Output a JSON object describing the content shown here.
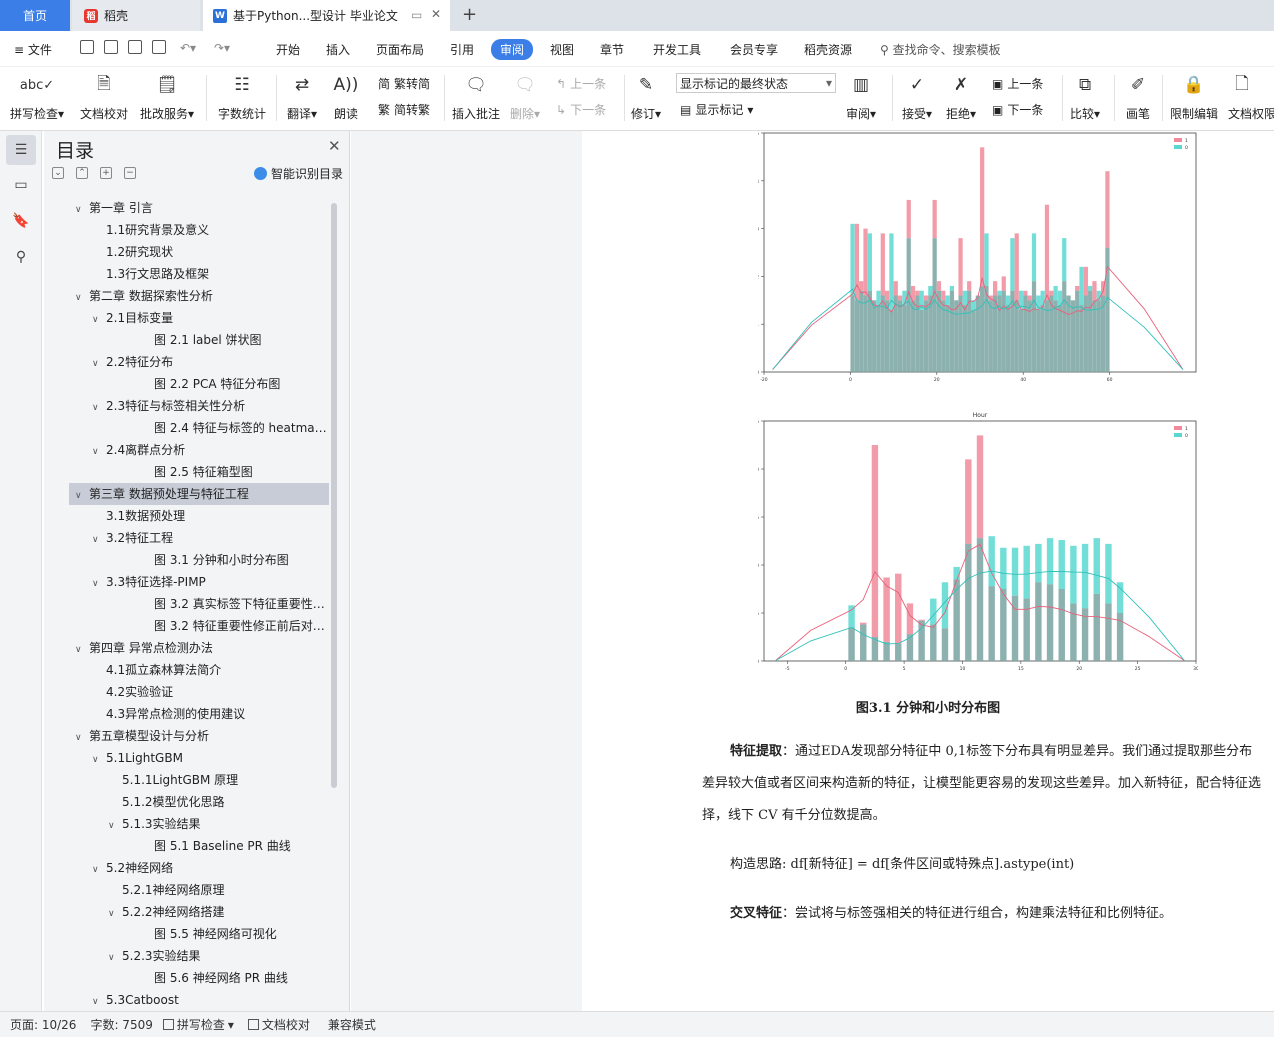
{
  "tabs": {
    "home": "首页",
    "wps": "稻壳",
    "doc": "基于Python...型设计 毕业论文",
    "new_tab": "+"
  },
  "menu": {
    "file": "文件",
    "items": [
      "开始",
      "插入",
      "页面布局",
      "引用",
      "审阅",
      "视图",
      "章节",
      "开发工具",
      "会员专享",
      "稻壳资源"
    ],
    "search": "查找命令、搜索模板"
  },
  "ribbon": {
    "spellcheck": "拼写检查",
    "doc_proof": "文档校对",
    "batch_service": "批改服务",
    "word_count": "字数统计",
    "translate": "翻译",
    "read_aloud": "朗读",
    "trad_to_simp": "繁转简",
    "simp_to_trad": "简转繁",
    "insert_comment": "插入批注",
    "delete": "删除",
    "prev_comment": "上一条",
    "next_comment": "下一条",
    "track": "修订",
    "display_mode": "显示标记的最终状态",
    "show_markup": "显示标记",
    "review": "审阅",
    "accept": "接受",
    "reject": "拒绝",
    "prev_change": "上一条",
    "next_change": "下一条",
    "compare": "比较",
    "pen": "画笔",
    "restrict_edit": "限制编辑",
    "doc_permission": "文档权限"
  },
  "toc": {
    "title": "目录",
    "smart_label": "智能识别目录",
    "items": [
      {
        "text": "第一章 引言",
        "level": 0,
        "caret": true
      },
      {
        "text": "1.1研究背景及意义",
        "level": 1,
        "caret": false
      },
      {
        "text": "1.2研究现状",
        "level": 1,
        "caret": false
      },
      {
        "text": "1.3行文思路及框架",
        "level": 1,
        "caret": false
      },
      {
        "text": "第二章 数据探索性分析",
        "level": 0,
        "caret": true
      },
      {
        "text": "2.1目标变量",
        "level": 1,
        "caret": true
      },
      {
        "text": "图 2.1 label 饼状图",
        "level": 3,
        "caret": false
      },
      {
        "text": "2.2特征分布",
        "level": 1,
        "caret": true
      },
      {
        "text": "图 2.2 PCA 特征分布图",
        "level": 3,
        "caret": false
      },
      {
        "text": "2.3特征与标签相关性分析",
        "level": 1,
        "caret": true
      },
      {
        "text": "图 2.4 特征与标签的 heatmap 相关性图",
        "level": 3,
        "caret": false
      },
      {
        "text": "2.4离群点分析",
        "level": 1,
        "caret": true
      },
      {
        "text": "图 2.5 特征箱型图",
        "level": 3,
        "caret": false
      },
      {
        "text": "第三章 数据预处理与特征工程",
        "level": 0,
        "caret": true,
        "selected": true
      },
      {
        "text": "3.1数据预处理",
        "level": 1,
        "caret": false
      },
      {
        "text": "3.2特征工程",
        "level": 1,
        "caret": true
      },
      {
        "text": "图 3.1 分钟和小时分布图",
        "level": 3,
        "caret": false
      },
      {
        "text": "3.3特征选择-PIMP",
        "level": 1,
        "caret": true
      },
      {
        "text": "图 3.2  真实标签下特征重要性分布图",
        "level": 3,
        "caret": false
      },
      {
        "text": "图 3.2 特征重要性修正前后对比图",
        "level": 3,
        "caret": false
      },
      {
        "text": "第四章 异常点检测办法",
        "level": 0,
        "caret": true
      },
      {
        "text": "4.1孤立森林算法简介",
        "level": 1,
        "caret": false
      },
      {
        "text": "4.2实验验证",
        "level": 1,
        "caret": false
      },
      {
        "text": "4.3异常点检测的使用建议",
        "level": 1,
        "caret": false
      },
      {
        "text": "第五章模型设计与分析",
        "level": 0,
        "caret": true
      },
      {
        "text": "5.1LightGBM",
        "level": 1,
        "caret": true
      },
      {
        "text": "5.1.1LightGBM 原理",
        "level": 2,
        "caret": false
      },
      {
        "text": "5.1.2模型优化思路",
        "level": 2,
        "caret": false
      },
      {
        "text": "5.1.3实验结果",
        "level": 2,
        "caret": true
      },
      {
        "text": "图 5.1 Baseline PR 曲线",
        "level": 3,
        "caret": false
      },
      {
        "text": "5.2神经网络",
        "level": 1,
        "caret": true
      },
      {
        "text": "5.2.1神经网络原理",
        "level": 2,
        "caret": false
      },
      {
        "text": "5.2.2神经网络搭建",
        "level": 2,
        "caret": true
      },
      {
        "text": "图 5.5 神经网络可视化",
        "level": 3,
        "caret": false
      },
      {
        "text": "5.2.3实验结果",
        "level": 2,
        "caret": true
      },
      {
        "text": "图 5.6  神经网络 PR 曲线",
        "level": 3,
        "caret": false
      },
      {
        "text": "5.3Catboost",
        "level": 1,
        "caret": true
      }
    ]
  },
  "document": {
    "figure_caption": "图3.1 分钟和小时分布图",
    "p1_bold": "特征提取",
    "p1_text": "：通过EDA发现部分特征中 0,1标签下分布具有明显差异。我们通过提取那些分布差异较大值或者区间来构造新的特征，让模型能更容易的发现这些差异。加入新特征，配合特征选择，线下 CV 有千分位数提高。",
    "p2_text": "构造思路: df[新特征] = df[条件区间或特殊点].astype(int)",
    "p3_bold": "交叉特征",
    "p3_text": "：尝试将与标签强相关的特征进行组合，构建乘法特征和比例特征。"
  },
  "chart_data": [
    {
      "type": "bar",
      "title": "",
      "xlabel": "",
      "ylabel": "Density",
      "xlim": [
        -20,
        80
      ],
      "ylim": [
        0,
        0.05
      ],
      "xticks": [
        -20,
        0,
        20,
        40,
        60
      ],
      "yticks": [
        0.0,
        0.01,
        0.02,
        0.03,
        0.04,
        0.05
      ],
      "legend": [
        "1",
        "0"
      ],
      "legend_position": "top-right",
      "colors": {
        "1": "#f08a9a",
        "0": "#5ad8d0",
        "overlap": "#7fa9a6"
      },
      "x": [
        0,
        1,
        2,
        3,
        4,
        5,
        6,
        7,
        8,
        9,
        10,
        11,
        12,
        13,
        14,
        15,
        16,
        17,
        18,
        19,
        20,
        21,
        22,
        23,
        24,
        25,
        26,
        27,
        28,
        29,
        30,
        31,
        32,
        33,
        34,
        35,
        36,
        37,
        38,
        39,
        40,
        41,
        42,
        43,
        44,
        45,
        46,
        47,
        48,
        49,
        50,
        51,
        52,
        53,
        54,
        55,
        56,
        57,
        58,
        59
      ],
      "series": [
        {
          "name": "1",
          "values": [
            0.016,
            0.031,
            0.019,
            0.03,
            0.017,
            0.015,
            0.014,
            0.029,
            0.017,
            0.013,
            0.019,
            0.016,
            0.014,
            0.036,
            0.018,
            0.017,
            0.013,
            0.016,
            0.016,
            0.036,
            0.019,
            0.017,
            0.014,
            0.017,
            0.015,
            0.028,
            0.014,
            0.019,
            0.013,
            0.016,
            0.047,
            0.018,
            0.016,
            0.019,
            0.016,
            0.02,
            0.014,
            0.017,
            0.029,
            0.013,
            0.017,
            0.016,
            0.019,
            0.013,
            0.014,
            0.035,
            0.017,
            0.015,
            0.014,
            0.019,
            0.016,
            0.015,
            0.018,
            0.014,
            0.022,
            0.017,
            0.019,
            0.015,
            0.019,
            0.042
          ]
        },
        {
          "name": "0",
          "values": [
            0.031,
            0.015,
            0.017,
            0.016,
            0.029,
            0.015,
            0.017,
            0.016,
            0.015,
            0.029,
            0.016,
            0.015,
            0.017,
            0.028,
            0.015,
            0.016,
            0.017,
            0.015,
            0.018,
            0.028,
            0.017,
            0.015,
            0.016,
            0.018,
            0.015,
            0.016,
            0.017,
            0.017,
            0.015,
            0.016,
            0.018,
            0.029,
            0.015,
            0.016,
            0.017,
            0.017,
            0.016,
            0.028,
            0.015,
            0.017,
            0.016,
            0.015,
            0.029,
            0.016,
            0.017,
            0.015,
            0.016,
            0.018,
            0.017,
            0.028,
            0.016,
            0.015,
            0.017,
            0.022,
            0.016,
            0.018,
            0.015,
            0.017,
            0.016,
            0.026
          ]
        }
      ]
    },
    {
      "type": "bar",
      "title": "Hour",
      "xlabel": "",
      "ylabel": "Density",
      "xlim": [
        -7,
        30
      ],
      "ylim": [
        0,
        0.25
      ],
      "xticks": [
        -5,
        0,
        5,
        10,
        15,
        20,
        25,
        30
      ],
      "yticks": [
        0.0,
        0.05,
        0.1,
        0.15,
        0.2,
        0.25
      ],
      "legend": [
        "1",
        "0"
      ],
      "legend_position": "top-right",
      "colors": {
        "1": "#f08a9a",
        "0": "#5ad8d0",
        "overlap": "#7fa9a6"
      },
      "x": [
        0,
        1,
        2,
        3,
        4,
        5,
        6,
        7,
        8,
        9,
        10,
        11,
        12,
        13,
        14,
        15,
        16,
        17,
        18,
        19,
        20,
        21,
        22,
        23
      ],
      "series": [
        {
          "name": "1",
          "values": [
            0.035,
            0.04,
            0.225,
            0.087,
            0.091,
            0.06,
            0.043,
            0.038,
            0.034,
            0.085,
            0.21,
            0.235,
            0.078,
            0.075,
            0.068,
            0.065,
            0.082,
            0.08,
            0.075,
            0.06,
            0.055,
            0.07,
            0.06,
            0.05
          ]
        },
        {
          "name": "0",
          "values": [
            0.058,
            0.038,
            0.025,
            0.02,
            0.018,
            0.028,
            0.042,
            0.065,
            0.082,
            0.098,
            0.122,
            0.128,
            0.13,
            0.118,
            0.118,
            0.12,
            0.122,
            0.128,
            0.126,
            0.12,
            0.122,
            0.128,
            0.122,
            0.082
          ]
        }
      ]
    }
  ],
  "status": {
    "page": "页面: 10/26",
    "words": "字数: 7509",
    "spell": "拼写检查",
    "proof": "文档校对",
    "compat": "兼容模式"
  }
}
